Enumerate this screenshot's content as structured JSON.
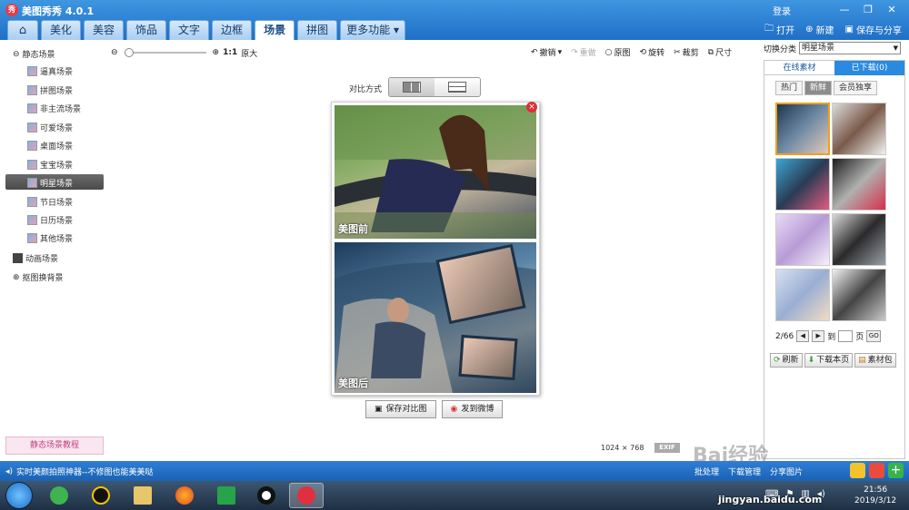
{
  "app": {
    "title": "美图秀秀 4.0.1",
    "logo": "秀",
    "login": "登录"
  },
  "window": {
    "minimize": "—",
    "restore": "❐",
    "close": "✕"
  },
  "tabs": [
    "美化",
    "美容",
    "饰品",
    "文字",
    "边框",
    "场景",
    "拼图",
    "更多功能"
  ],
  "active_tab": "场景",
  "header_actions": {
    "open": "打开",
    "new": "新建",
    "save_share": "保存与分享"
  },
  "sidebar": {
    "group_static": "静态场景",
    "items": [
      "逼真场景",
      "拼图场景",
      "非主流场景",
      "可爱场景",
      "桌面场景",
      "宝宝场景",
      "明星场景",
      "节日场景",
      "日历场景",
      "其他场景"
    ],
    "selected": "明星场景",
    "group_animated": "动画场景",
    "group_cutout": "抠图换背景",
    "tutorial": "静态场景教程"
  },
  "zoom": {
    "ratio": "1:1",
    "label": "原大"
  },
  "edit_tools": {
    "undo": "撤销",
    "redo": "重做",
    "original": "原图",
    "rotate": "旋转",
    "crop": "裁剪",
    "size": "尺寸"
  },
  "compare": {
    "label": "对比方式"
  },
  "photos": {
    "before_label": "美图前",
    "after_label": "美图后"
  },
  "photo_actions": {
    "save_compare": "保存对比图",
    "post_weibo": "发到微博"
  },
  "image_info": {
    "size": "1024 × 768",
    "exif": "EXIF"
  },
  "right_panel": {
    "category_label": "切换分类",
    "category_value": "明星场景",
    "tabs": [
      "在线素材",
      "已下载(0)"
    ],
    "filters": [
      "热门",
      "新鲜",
      "会员独享"
    ],
    "active_filter": "新鲜",
    "pager": {
      "current": "2/66",
      "goto_label": "到",
      "page_unit": "页",
      "go": "GO"
    },
    "actions": [
      "刷新",
      "下载本页",
      "素材包"
    ]
  },
  "status": {
    "text": "实时美颜拍照神器--不修图也能美美哒",
    "links": [
      "批处理",
      "下载管理",
      "分享图片"
    ]
  },
  "taskbar": {
    "time": "21:56",
    "date": "2019/3/12"
  },
  "watermark": {
    "text": "Bai经验",
    "url": "jingyan.baidu.com"
  }
}
